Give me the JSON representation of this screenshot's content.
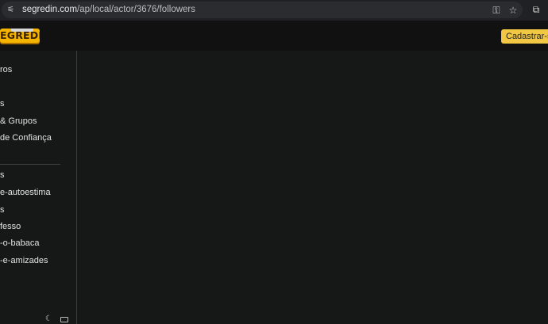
{
  "browser": {
    "url_host": "segredin.com",
    "url_path": "/ap/local/actor/3676/followers",
    "icons": [
      "site-info-icon",
      "password-key-icon",
      "star-icon",
      "extensions-icon"
    ]
  },
  "header": {
    "logo_text": "EGREDIN",
    "signup_label": "Cadastrar-se"
  },
  "sidebar": {
    "items_top": [
      {
        "label": "ros"
      },
      {
        "label": "s"
      },
      {
        "label": " & Grupos"
      },
      {
        "label": " de Confiança"
      }
    ],
    "items_bottom": [
      {
        "label": "s"
      },
      {
        "label": "e-autoestima"
      },
      {
        "label": "s"
      },
      {
        "label": "fesso"
      },
      {
        "label": "-o-babaca"
      },
      {
        "label": "-e-amizades"
      }
    ],
    "footer_icons": [
      "moon-icon",
      "keyboard-icon"
    ]
  },
  "colors": {
    "background": "#161817",
    "header_bg": "#101110",
    "accent": "#f2c744",
    "logo": "#f4b400"
  }
}
